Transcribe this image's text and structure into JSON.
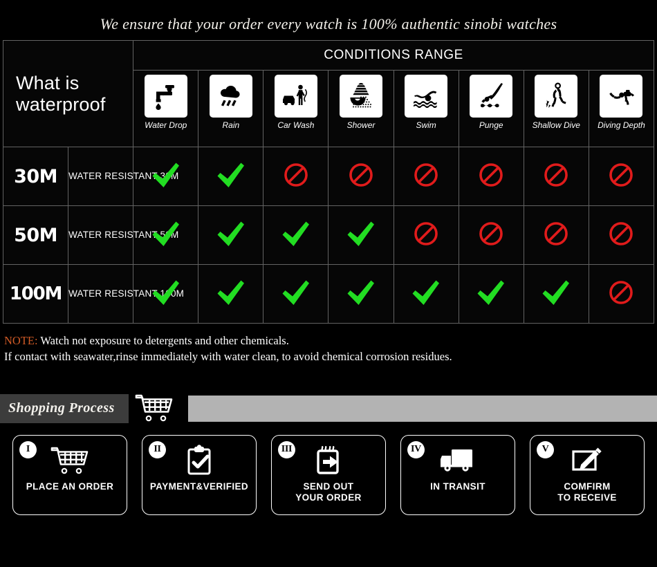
{
  "header": {
    "title": "We ensure that your order every watch is 100% authentic sinobi watches"
  },
  "waterproof_table": {
    "left_header": "What is waterproof",
    "conditions_title": "CONDITIONS RANGE",
    "columns": [
      {
        "label": "Water Drop",
        "icon": "water-drop-icon"
      },
      {
        "label": "Rain",
        "icon": "rain-icon"
      },
      {
        "label": "Car Wash",
        "icon": "car-wash-icon"
      },
      {
        "label": "Shower",
        "icon": "shower-icon"
      },
      {
        "label": "Swim",
        "icon": "swim-icon"
      },
      {
        "label": "Punge",
        "icon": "punge-icon"
      },
      {
        "label": "Shallow\nDive",
        "icon": "shallow-dive-icon"
      },
      {
        "label": "Diving\nDepth",
        "icon": "diving-depth-icon"
      }
    ],
    "rows": [
      {
        "depth": "30M",
        "description": "WATER RESISTANT  30M",
        "marks": [
          "yes",
          "yes",
          "no",
          "no",
          "no",
          "no",
          "no",
          "no"
        ]
      },
      {
        "depth": "50M",
        "description": "WATER RESISTANT 50M",
        "marks": [
          "yes",
          "yes",
          "yes",
          "yes",
          "no",
          "no",
          "no",
          "no"
        ]
      },
      {
        "depth": "100M",
        "description": "WATER RESISTANT  100M",
        "marks": [
          "yes",
          "yes",
          "yes",
          "yes",
          "yes",
          "yes",
          "yes",
          "no"
        ]
      }
    ],
    "mark_colors": {
      "yes": "#22dd22",
      "no": "#e01b1b"
    }
  },
  "note": {
    "keyword": "NOTE:",
    "line1": " Watch not exposure to detergents and other chemicals.",
    "line2": "If contact with seawater,rinse immediately with water clean, to avoid chemical corrosion residues.",
    "keyword_color": "#cf5a26"
  },
  "shopping_process": {
    "label": "Shopping Process",
    "cart_icon": "shopping-cart-icon",
    "band_color": "#b3b3b3"
  },
  "steps": [
    {
      "numeral": "I",
      "label": "PLACE AN ORDER",
      "icon": "shopping-cart-icon"
    },
    {
      "numeral": "II",
      "label": "PAYMENT&VERIFIED",
      "icon": "clipboard-check-icon"
    },
    {
      "numeral": "III",
      "label": "SEND OUT\nYOUR ORDER",
      "icon": "send-package-icon"
    },
    {
      "numeral": "IV",
      "label": "IN TRANSIT",
      "icon": "delivery-truck-icon"
    },
    {
      "numeral": "V",
      "label": "COMFIRM\nTO RECEIVE",
      "icon": "confirm-pencil-icon"
    }
  ]
}
